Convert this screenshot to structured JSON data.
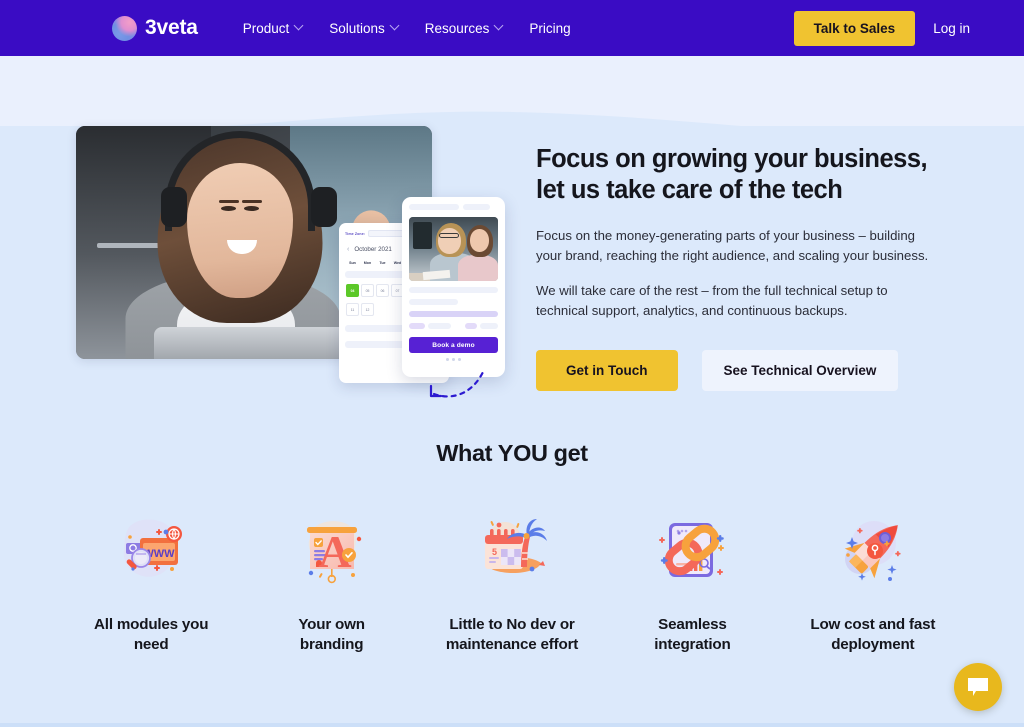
{
  "navbar": {
    "logo_text": "3veta",
    "links": [
      {
        "label": "Product",
        "has_caret": true
      },
      {
        "label": "Solutions",
        "has_caret": true
      },
      {
        "label": "Resources",
        "has_caret": true
      },
      {
        "label": "Pricing",
        "has_caret": false
      }
    ],
    "cta_label": "Talk to Sales",
    "login_label": "Log in",
    "bg_color": "#3a0cc4",
    "cta_color": "#f0c330"
  },
  "hero": {
    "title": "Focus on growing your business,\nlet us take care of the tech",
    "paragraph_1": "Focus on the money-generating parts of your business – building your brand, reaching the right audience, and scaling your business.",
    "paragraph_2": "We will take care of the rest – from the full technical setup to technical support, analytics, and continuous backups.",
    "primary_cta": "Get in Touch",
    "secondary_cta": "See Technical Overview",
    "widget": {
      "timezone_label": "Time Zone:",
      "month_label": "October 2021",
      "prev_arrow": "‹",
      "weekdays": [
        "Sun",
        "Mon",
        "Tue",
        "Wed",
        "Thu"
      ],
      "days_row_1": [
        "04",
        "05",
        "06",
        "07"
      ],
      "days_row_2": [
        "11",
        "12"
      ],
      "selected_day": "04",
      "selected_color": "#5cc828",
      "book_button": "Book a demo",
      "book_button_color": "#5721d4"
    }
  },
  "features": {
    "title": "What YOU get",
    "items": [
      {
        "icon": "www-browser-search-icon",
        "label": "All modules you\nneed"
      },
      {
        "icon": "branding-letter-a-icon",
        "label": "Your own\nbranding"
      },
      {
        "icon": "calendar-palm-tree-icon",
        "label": "Little to No dev or\nmaintenance effort"
      },
      {
        "icon": "chain-link-integration-icon",
        "label": "Seamless\nintegration"
      },
      {
        "icon": "rocket-launch-icon",
        "label": "Low cost and fast\ndeployment"
      }
    ]
  },
  "chat_widget": {
    "icon": "chat-bubble-icon",
    "color": "#e8b81d"
  },
  "theme": {
    "page_bg": "#dce9fb",
    "band_bg": "#eaf0fd",
    "accent_purple": "#3a0cc4",
    "accent_yellow": "#f0c330",
    "text_dark": "#15161d"
  }
}
